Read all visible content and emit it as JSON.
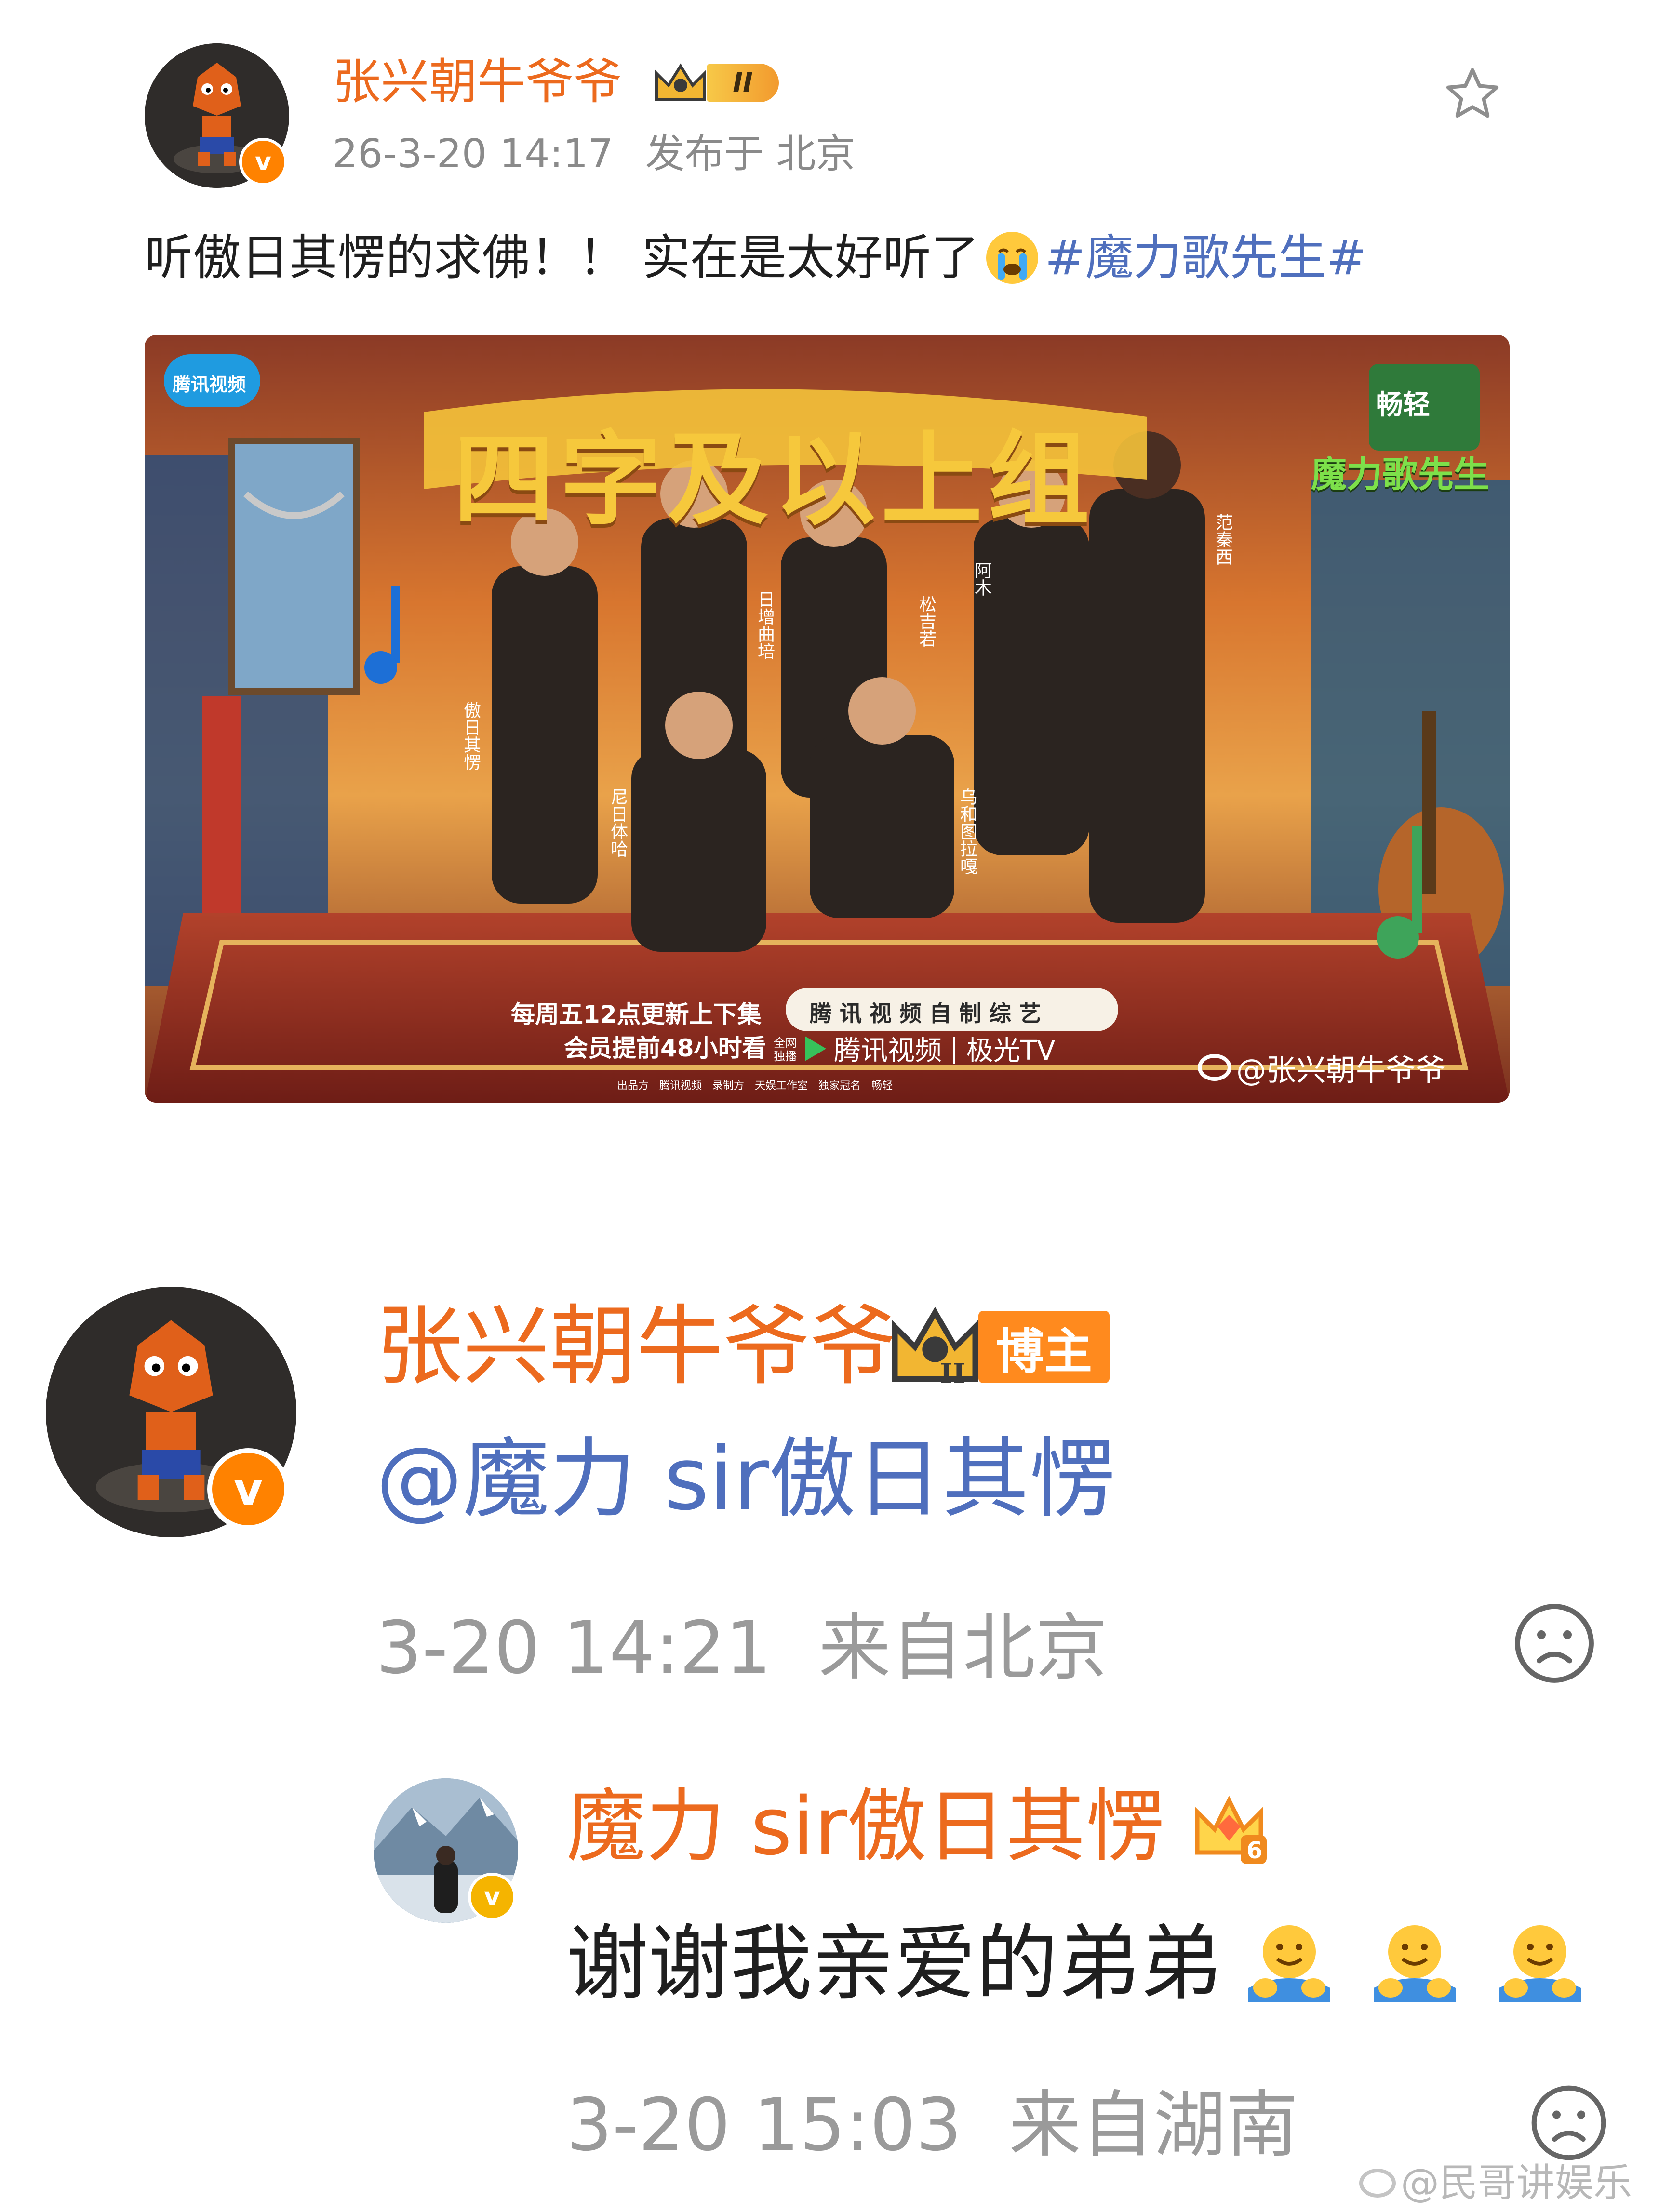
{
  "post": {
    "author": "张兴朝牛爷爷",
    "level_badge": "II",
    "time": "26-3-20 14:17",
    "location": "发布于 北京",
    "text": "听傲日其愣的求佛！！ 实在是太好听了",
    "hashtag": "#魔力歌先生#",
    "poster": {
      "platform_logo": "腾讯视频",
      "headline": "四字及以上组",
      "brand_logo_top": "畅轻",
      "show_logo": "魔力歌先生",
      "schedule_line1": "每周五12点更新上下集",
      "schedule_line2": "会员提前48小时看",
      "original_label": "腾 讯 视 频 自 制 综 艺",
      "streaming_label": "腾讯视频",
      "tv_label": "极光TV",
      "broadcast_note": "全网独播",
      "watermark": "@张兴朝牛爷爷",
      "credits": [
        "出品方",
        "腾讯视频",
        "录制方",
        "天娱工作室",
        "独家冠名",
        "畅轻"
      ],
      "performer_names": [
        "傲日其愣",
        "日增曲培",
        "尼日体哈",
        "松吉若",
        "乌和图拉嘎",
        "阿木",
        "范秦西"
      ]
    }
  },
  "comments": [
    {
      "author": "张兴朝牛爷爷",
      "role_badge": "博主",
      "crown_level": "II",
      "text": "@魔力 sir傲日其愣",
      "time": "3-20 14:21",
      "location": "来自北京"
    },
    {
      "author": "魔力 sir傲日其愣",
      "crown_level": "6",
      "text": "谢谢我亲爱的弟弟",
      "time": "3-20 15:03",
      "location": "来自湖南"
    }
  ],
  "page_watermark": "@民哥讲娱乐",
  "icons": [
    "star-icon",
    "crying-emoji-icon",
    "sad-face-icon",
    "hug-emoji-icon",
    "weibo-logo-icon",
    "verified-badge-icon",
    "crown-icon"
  ],
  "colors": {
    "username": "#ec6a1e",
    "link": "#4f6fbd",
    "meta": "#8a8a8a",
    "verified": "#ff8200"
  }
}
